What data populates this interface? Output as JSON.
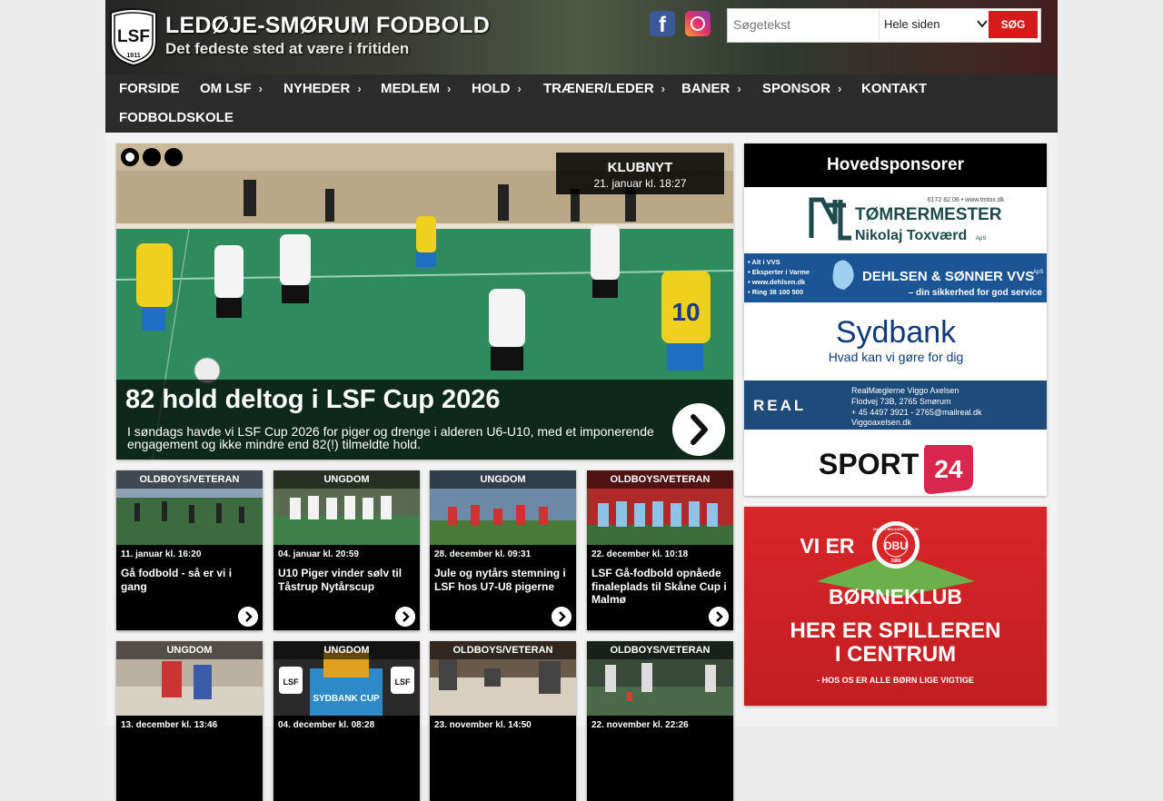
{
  "header": {
    "logo_text": "LSF",
    "logo_year": "1911",
    "title": "LEDØJE-SMØRUM FODBOLD",
    "tagline": "Det fedeste sted at være i fritiden",
    "facebook_letter": "f",
    "search": {
      "placeholder": "Søgetekst",
      "scope": "Hele siden",
      "button": "SØG"
    }
  },
  "nav": {
    "items": [
      {
        "label": "FORSIDE"
      },
      {
        "label": "OM LSF",
        "arrow": "›"
      },
      {
        "label": "NYHEDER",
        "arrow": "›"
      },
      {
        "label": "MEDLEM",
        "arrow": "›"
      },
      {
        "label": "HOLD",
        "arrow": "›"
      },
      {
        "label": "TRÆNER/LEDER",
        "arrow": "›"
      },
      {
        "label": "BANER",
        "arrow": "›"
      },
      {
        "label": "SPONSOR",
        "arrow": "›"
      },
      {
        "label": "KONTAKT"
      },
      {
        "label": "FODBOLDSKOLE"
      }
    ]
  },
  "hero": {
    "category": "KLUBNYT",
    "date": "21. januar kl. 18:27",
    "title": "82 hold deltog i LSF Cup 2026",
    "text": "I søndags havde vi LSF Cup 2026 for piger og drenge i alderen U6-U10, med et imponerende engagement og ikke mindre end 82(!) tilmeldte hold.",
    "jersey_number": "10"
  },
  "cards": [
    {
      "tag": "OLDBOYS/VETERAN",
      "date": "11. januar kl. 16:20",
      "title": "Gå fodbold - så er vi i gang"
    },
    {
      "tag": "UNGDOM",
      "date": "04. januar kl. 20:59",
      "title": "U10 Piger vinder sølv til Tåstrup Nytårscup"
    },
    {
      "tag": "UNGDOM",
      "date": "28. december kl. 09:31",
      "title": "Jule og nytårs stemning i LSF hos U7-U8 pigerne"
    },
    {
      "tag": "OLDBOYS/VETERAN",
      "date": "22. december kl. 10:18",
      "title": "LSF Gå-fodbold opnåede finaleplads til Skåne Cup i Malmø"
    },
    {
      "tag": "UNGDOM",
      "date": "13. december kl. 13:46",
      "title": ""
    },
    {
      "tag": "UNGDOM",
      "date": "04. december kl. 08:28",
      "title": ""
    },
    {
      "tag": "OLDBOYS/VETERAN",
      "date": "23. november kl. 14:50",
      "title": ""
    },
    {
      "tag": "OLDBOYS/VETERAN",
      "date": "22. november kl. 22:26",
      "title": ""
    }
  ],
  "card5_badge": "LSF",
  "card5_sign": "SYDBANK CUP",
  "sidebar": {
    "heading": "Hovedsponsorer",
    "sponsors": {
      "tomrer": {
        "small": "6172 82 06 • www.tmtox.dk",
        "line1": "TØMRERMESTER",
        "line2": "Nikolaj Toxværd",
        "suffix": "ApS"
      },
      "dehlsen": {
        "left1": "• Alt i VVS",
        "left2": "• Eksperter i Varme",
        "left3": "• www.dehlsen.dk",
        "left4": "• Ring 38 100 500",
        "name": "DEHLSEN & SØNNER VVS",
        "suffix": "ApS",
        "slogan": "– din sikkerhed for god service"
      },
      "sydbank": {
        "name": "Sydbank",
        "slogan": "Hvad kan vi gøre for dig"
      },
      "real": {
        "logo": "REAL",
        "line1": "RealMæglerne Viggo Axelsen",
        "line2": "Flodvej 73B, 2765 Smørum",
        "line3": "+ 45 4497 3921 - 2765@mailreal.dk",
        "line4": "Viggoaxelsen.dk"
      },
      "sport24": {
        "name": "SPORT",
        "num": "24"
      }
    },
    "dbu": {
      "line1": "VI ER",
      "line2": "BØRNEKLUB",
      "line3": "HER ER SPILLEREN",
      "line4": "I CENTRUM",
      "line5": "- HOS OS ER ALLE BØRN LIGE VIGTIGE",
      "badge": "DBU",
      "badge_ring": "DANSK BOLDSPIL-UNION",
      "badge_year": "1889"
    }
  },
  "colors": {
    "accent_red": "#d51a1a",
    "nav_bg": "#2c2c2c",
    "sydbank_blue": "#0e3a7a",
    "real_blue": "#1f4b7a",
    "dehlsen_blue": "#1c5596",
    "sport24_red": "#d8264d",
    "tomrer_teal": "#1d4a4a"
  }
}
